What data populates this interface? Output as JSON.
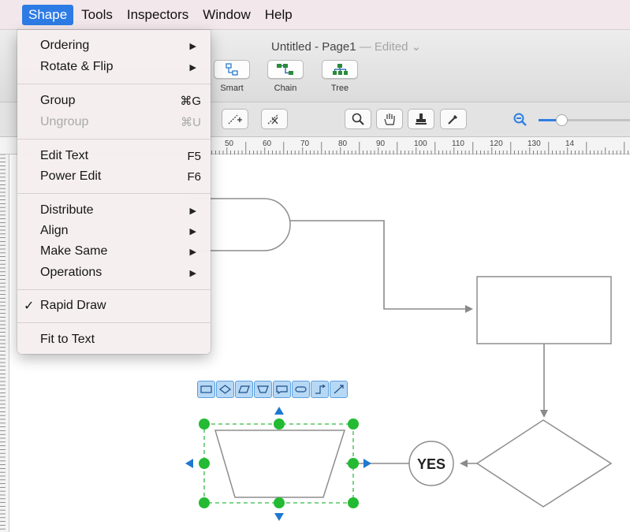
{
  "menubar": {
    "items": [
      "Shape",
      "Tools",
      "Inspectors",
      "Window",
      "Help"
    ]
  },
  "window": {
    "title": "Untitled - Page1",
    "separator": " — ",
    "status": "Edited",
    "status_chevron": "⌄"
  },
  "toolbar": {
    "buttons": [
      {
        "label": "Smart",
        "icon": "smart-connector-icon"
      },
      {
        "label": "Chain",
        "icon": "chain-icon"
      },
      {
        "label": "Tree",
        "icon": "tree-icon"
      }
    ]
  },
  "toolstrip": {
    "tools": [
      "connector-add-icon",
      "connector-remove-icon",
      "zoom-icon",
      "hand-icon",
      "stamp-icon",
      "eyedropper-icon"
    ],
    "zoom_icon": "zoom-out-icon",
    "zoom_level": 0.25
  },
  "ruler": {
    "labels": [
      "50",
      "60",
      "70",
      "80",
      "90",
      "100",
      "110",
      "120",
      "130",
      "14"
    ]
  },
  "shape_menu": {
    "items": [
      {
        "label": "Ordering",
        "submenu": true
      },
      {
        "label": "Rotate & Flip",
        "submenu": true
      },
      {
        "label": "Group",
        "shortcut": "⌘G"
      },
      {
        "label": "Ungroup",
        "shortcut": "⌘U",
        "disabled": true
      },
      {
        "label": "Edit Text",
        "shortcut": "F5"
      },
      {
        "label": "Power Edit",
        "shortcut": "F6"
      },
      {
        "label": "Distribute",
        "submenu": true
      },
      {
        "label": "Align",
        "submenu": true
      },
      {
        "label": "Make Same",
        "submenu": true
      },
      {
        "label": "Operations",
        "submenu": true
      },
      {
        "label": "Rapid Draw",
        "checked": true
      },
      {
        "label": "Fit to Text"
      }
    ],
    "submenu_arrow": "▶",
    "checkmark": "✓"
  },
  "diagram": {
    "yes_label": "YES"
  },
  "shape_toolbar": {
    "types": [
      "rectangle-icon",
      "diamond-icon",
      "parallelogram-icon",
      "trapezoid-icon",
      "document-icon",
      "rounded-rect-icon",
      "elbow-connector-icon",
      "straight-connector-icon"
    ]
  },
  "colors": {
    "menubar_bg": "#f2e7ea",
    "menu_highlight": "#2d7be5",
    "selection_handle": "#22bb33",
    "selection_dash": "#33bb44",
    "arrow_handle": "#1e78d0",
    "connector": "#8a8a8a",
    "shape_toolbar_fill": "#b7d8f5"
  }
}
